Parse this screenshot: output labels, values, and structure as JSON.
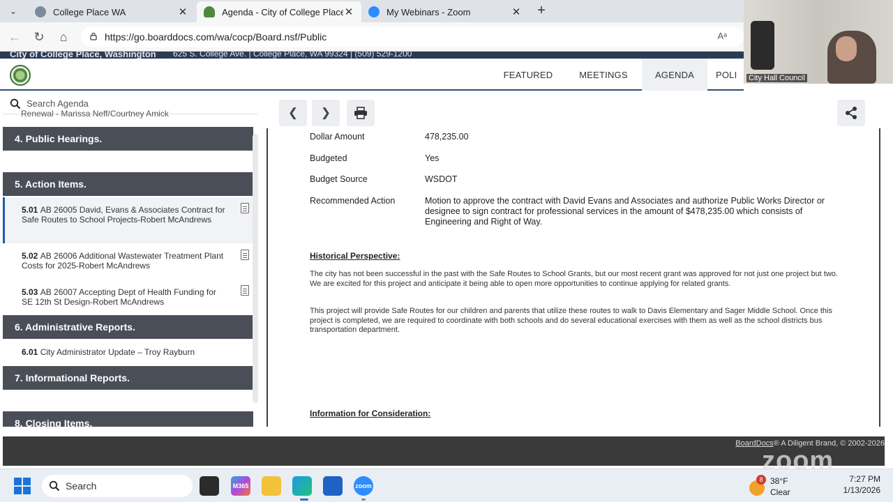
{
  "browser": {
    "tabs": [
      {
        "label": "College Place WA"
      },
      {
        "label": "Agenda - City of College Place, W"
      },
      {
        "label": "My Webinars - Zoom"
      }
    ],
    "url": "https://go.boarddocs.com/wa/cocp/Board.nsf/Public"
  },
  "site": {
    "org_title": "City of College Place, Washington",
    "org_address": "625 S. College Ave. | College Place, WA 99324 | (509) 529-1200",
    "nav": [
      {
        "label": "FEATURED"
      },
      {
        "label": "MEETINGS"
      },
      {
        "label": "AGENDA"
      },
      {
        "label": "POLI"
      }
    ]
  },
  "sidebar": {
    "search_placeholder": "Search Agenda",
    "cut_line": "Renewal - Marissa Neff/Courtney Amick",
    "sections": [
      {
        "label": "4. Public Hearings."
      },
      {
        "label": "5. Action Items."
      },
      {
        "label": "6. Administrative Reports."
      },
      {
        "label": "7. Informational Reports."
      },
      {
        "label": "8. Closing Items."
      }
    ],
    "items": [
      {
        "num": "5.01",
        "text": "AB 26005 David, Evans & Associates Contract for Safe Routes to School Projects-Robert McAndrews"
      },
      {
        "num": "5.02",
        "text": "AB 26006 Additional Wastewater Treatment Plant Costs for 2025-Robert McAndrews"
      },
      {
        "num": "5.03",
        "text": "AB 26007 Accepting Dept of Health Funding for SE 12th St Design-Robert McAndrews"
      },
      {
        "num": "6.01",
        "text": "City Administrator Update – Troy Rayburn"
      }
    ]
  },
  "detail": {
    "fields": [
      {
        "key": "Dollar Amount",
        "value": "478,235.00"
      },
      {
        "key": "Budgeted",
        "value": "Yes"
      },
      {
        "key": "Budget Source",
        "value": "WSDOT"
      },
      {
        "key": "Recommended Action",
        "value": "Motion to approve the contract with David Evans and Associates and authorize Public Works Director or designee to sign contract for professional services in the amount of $478,235.00 which consists of Engineering and Right of Way."
      }
    ],
    "historical_heading": "Historical Perspective:",
    "paragraph1": "The city has not been successful in the past with the Safe Routes to School Grants, but our most recent grant was approved for not just one project but two. We are excited for this project and anticipate it being able to open more opportunities to continue applying for related grants.",
    "paragraph2": "This project will provide Safe Routes for our children and parents that utilize these routes to walk to Davis Elementary and Sager Middle School. Once this project is completed, we are required to coordinate with both schools and do several educational exercises with them as well as the school districts bus transportation department.",
    "consideration_heading": "Information for Consideration:"
  },
  "footer": {
    "brand_link": "BoardDocs",
    "text": "® A Diligent Brand, © 2002-2026"
  },
  "zoom": {
    "watermark": "zoom",
    "camera_label": "City Hall Council"
  },
  "taskbar": {
    "search": "Search",
    "weather_temp": "38°F",
    "weather_cond": "Clear",
    "weather_badge": "8",
    "time": "7:27 PM",
    "date": "1/13/2026",
    "icon_labels": {
      "m365": "M365",
      "zoom": "zoom"
    }
  }
}
